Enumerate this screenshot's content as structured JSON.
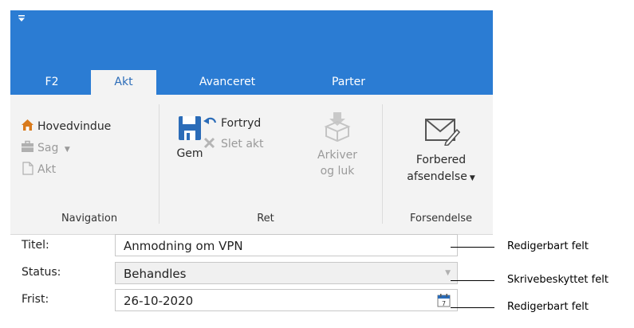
{
  "tabs": [
    {
      "label": "F2"
    },
    {
      "label": "Akt"
    },
    {
      "label": "Avanceret"
    },
    {
      "label": "Parter"
    }
  ],
  "ribbon": {
    "navigation": {
      "hovedvindue": "Hovedvindue",
      "sag": "Sag",
      "akt": "Akt",
      "group_label": "Navigation"
    },
    "ret": {
      "gem": "Gem",
      "fortryd": "Fortryd",
      "slet_akt": "Slet akt",
      "arkiver_line1": "Arkiver",
      "arkiver_line2": "og luk",
      "group_label": "Ret"
    },
    "forsendelse": {
      "forbered_line1": "Forbered",
      "forbered_line2": "afsendelse",
      "group_label": "Forsendelse"
    }
  },
  "form": {
    "titel_label": "Titel:",
    "titel_value": "Anmodning om VPN",
    "status_label": "Status:",
    "status_value": "Behandles",
    "frist_label": "Frist:",
    "frist_value": "26-10-2020"
  },
  "callouts": {
    "titel": "Redigerbart felt",
    "status": "Skrivebeskyttet felt",
    "frist": "Redigerbart felt"
  },
  "colors": {
    "accent": "#2b7cd3",
    "ribbon_bg": "#f3f3f3",
    "readonly_bg": "#f0f0f0"
  }
}
